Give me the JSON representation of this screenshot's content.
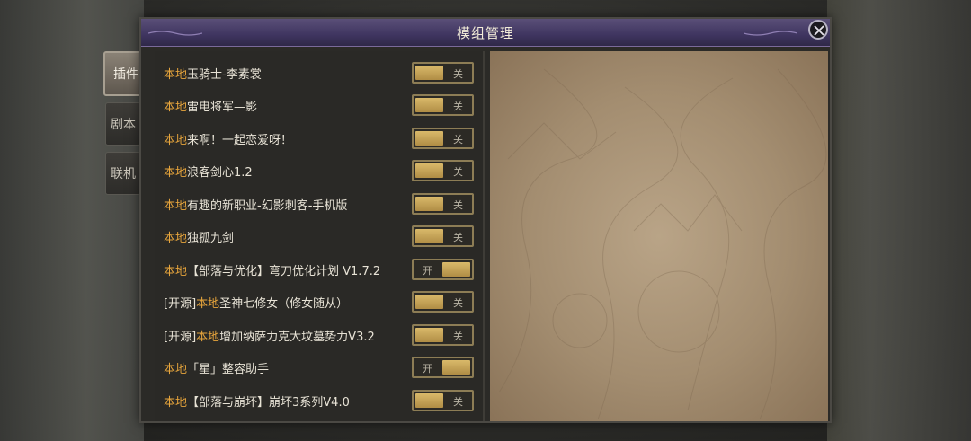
{
  "dialog": {
    "title": "模组管理"
  },
  "tabs": [
    {
      "label": "插件",
      "active": true
    },
    {
      "label": "剧本",
      "active": false
    },
    {
      "label": "联机",
      "active": false
    }
  ],
  "mods": [
    {
      "prefix": "",
      "local": "本地",
      "name": "玉骑士-李素裳",
      "state": "关",
      "enabled": false
    },
    {
      "prefix": "",
      "local": "本地",
      "name": "雷电将军—影",
      "state": "关",
      "enabled": false
    },
    {
      "prefix": "",
      "local": "本地",
      "name": "来啊！一起恋爱呀！",
      "state": "关",
      "enabled": false
    },
    {
      "prefix": "",
      "local": "本地",
      "name": "浪客剑心1.2",
      "state": "关",
      "enabled": false
    },
    {
      "prefix": "",
      "local": "本地",
      "name": "有趣的新职业-幻影刺客-手机版",
      "state": "关",
      "enabled": false
    },
    {
      "prefix": "",
      "local": "本地",
      "name": "独孤九剑",
      "state": "关",
      "enabled": false
    },
    {
      "prefix": "",
      "local": "本地",
      "name": "【部落与优化】弯刀优化计划 V1.7.2",
      "state": "开",
      "enabled": true
    },
    {
      "prefix": "[开源]",
      "local": "本地",
      "name": "圣神七修女（修女随从）",
      "state": "关",
      "enabled": false
    },
    {
      "prefix": "[开源]",
      "local": "本地",
      "name": "增加纳萨力克大坟墓势力V3.2",
      "state": "关",
      "enabled": false
    },
    {
      "prefix": "",
      "local": "本地",
      "name": "「星」整容助手",
      "state": "开",
      "enabled": true
    },
    {
      "prefix": "",
      "local": "本地",
      "name": "【部落与崩坏】崩坏3系列V4.0",
      "state": "关",
      "enabled": false
    }
  ],
  "colors": {
    "local_tag": "#e7a53c",
    "toggle_gold": "#d9b96a",
    "title_bar": "#3f3560"
  },
  "icons": {
    "close": "close-icon"
  }
}
